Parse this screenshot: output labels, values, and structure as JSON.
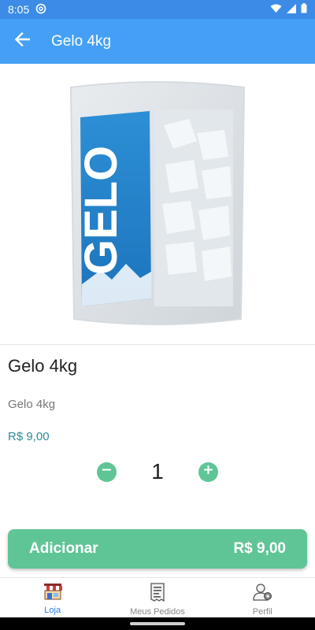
{
  "status_bar": {
    "time": "8:05"
  },
  "app_bar": {
    "title": "Gelo 4kg"
  },
  "product": {
    "image_text": "GELO",
    "name": "Gelo 4kg",
    "description": "Gelo 4kg",
    "price": "R$ 9,00"
  },
  "quantity": {
    "value": "1"
  },
  "add_button": {
    "label": "Adicionar",
    "total": "R$ 9,00"
  },
  "bottom_nav": {
    "items": [
      {
        "label": "Loja",
        "icon": "store-icon",
        "active": true
      },
      {
        "label": "Meus Pedidos",
        "icon": "receipt-icon",
        "active": false
      },
      {
        "label": "Perfil",
        "icon": "user-settings-icon",
        "active": false
      }
    ]
  },
  "colors": {
    "status_bar": "#3c8ce7",
    "app_bar": "#45a0f5",
    "accent_green": "#5fc596",
    "price_text": "#2a8a9a",
    "nav_active": "#2a7de1"
  }
}
